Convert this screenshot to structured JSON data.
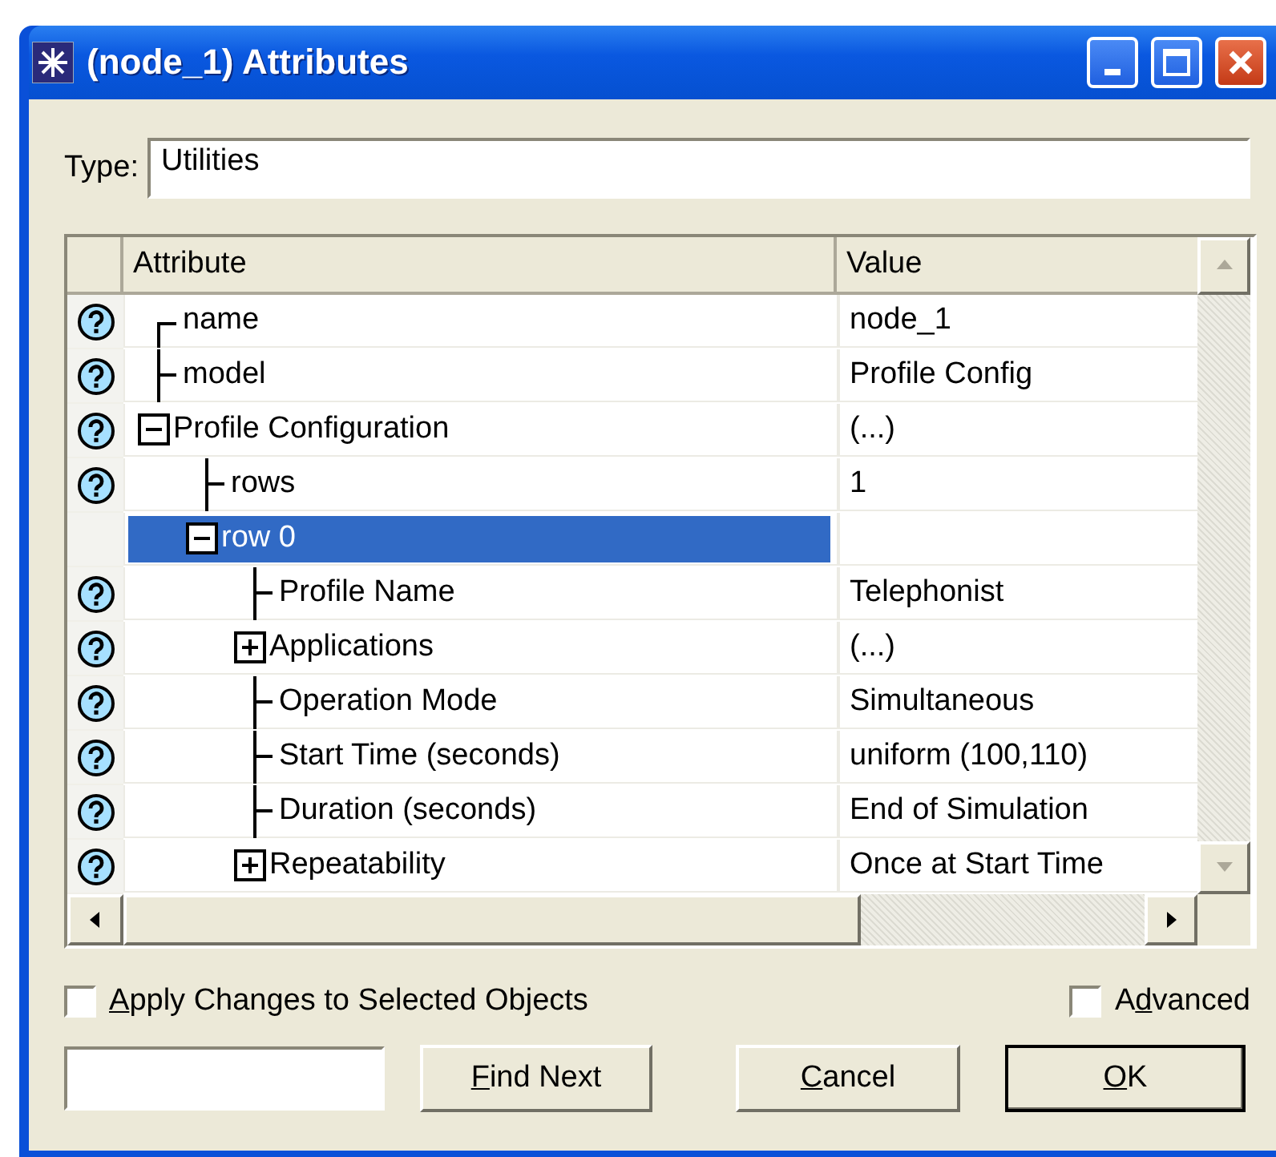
{
  "window": {
    "title": "(node_1) Attributes"
  },
  "type_field": {
    "label": "Type:",
    "value": "Utilities"
  },
  "table": {
    "columns": [
      "Attribute",
      "Value"
    ],
    "rows": [
      {
        "attribute": "name",
        "value": "node_1",
        "help": true,
        "selected": false
      },
      {
        "attribute": "model",
        "value": "Profile Config",
        "help": true,
        "selected": false
      },
      {
        "attribute": "Profile Configuration",
        "value": "(...)",
        "help": true,
        "selected": false,
        "expanded": true,
        "children": [
          {
            "attribute": "rows",
            "value": "1",
            "help": true,
            "selected": false
          },
          {
            "attribute": "row 0",
            "help": false,
            "selected": true,
            "expanded": true,
            "children": [
              {
                "attribute": "Profile Name",
                "value": "Telephonist",
                "help": true,
                "selected": false
              },
              {
                "attribute": "Applications",
                "value": "(...)",
                "help": true,
                "selected": false,
                "expanded": false
              },
              {
                "attribute": "Operation Mode",
                "value": "Simultaneous",
                "help": true,
                "selected": false
              },
              {
                "attribute": "Start Time (seconds)",
                "value": "uniform (100,110)",
                "help": true,
                "selected": false
              },
              {
                "attribute": "Duration (seconds)",
                "value": "End of Simulation",
                "help": true,
                "selected": false
              },
              {
                "attribute": "Repeatability",
                "value": "Once at Start Time",
                "help": true,
                "selected": false,
                "expanded": false
              }
            ]
          }
        ]
      }
    ]
  },
  "options": [
    {
      "label": [
        {
          "text": "A",
          "underlined": true
        },
        {
          "text": "pply Changes to Selected Objects",
          "underlined": false
        }
      ],
      "checked": false
    },
    {
      "label": [
        {
          "text": "A",
          "underlined": false
        },
        {
          "text": "d",
          "underlined": true
        },
        {
          "text": "vanced",
          "underlined": false
        }
      ],
      "checked": false
    }
  ],
  "buttons": [
    {
      "label": [
        {
          "text": "F",
          "underlined": true
        },
        {
          "text": "ind Next",
          "underlined": false
        }
      ],
      "default": false
    },
    {
      "label": [
        {
          "text": "C",
          "underlined": true
        },
        {
          "text": "ancel",
          "underlined": false
        }
      ],
      "default": false
    },
    {
      "label": [
        {
          "text": "O",
          "underlined": true
        },
        {
          "text": "K",
          "underlined": false
        }
      ],
      "default": true
    }
  ]
}
